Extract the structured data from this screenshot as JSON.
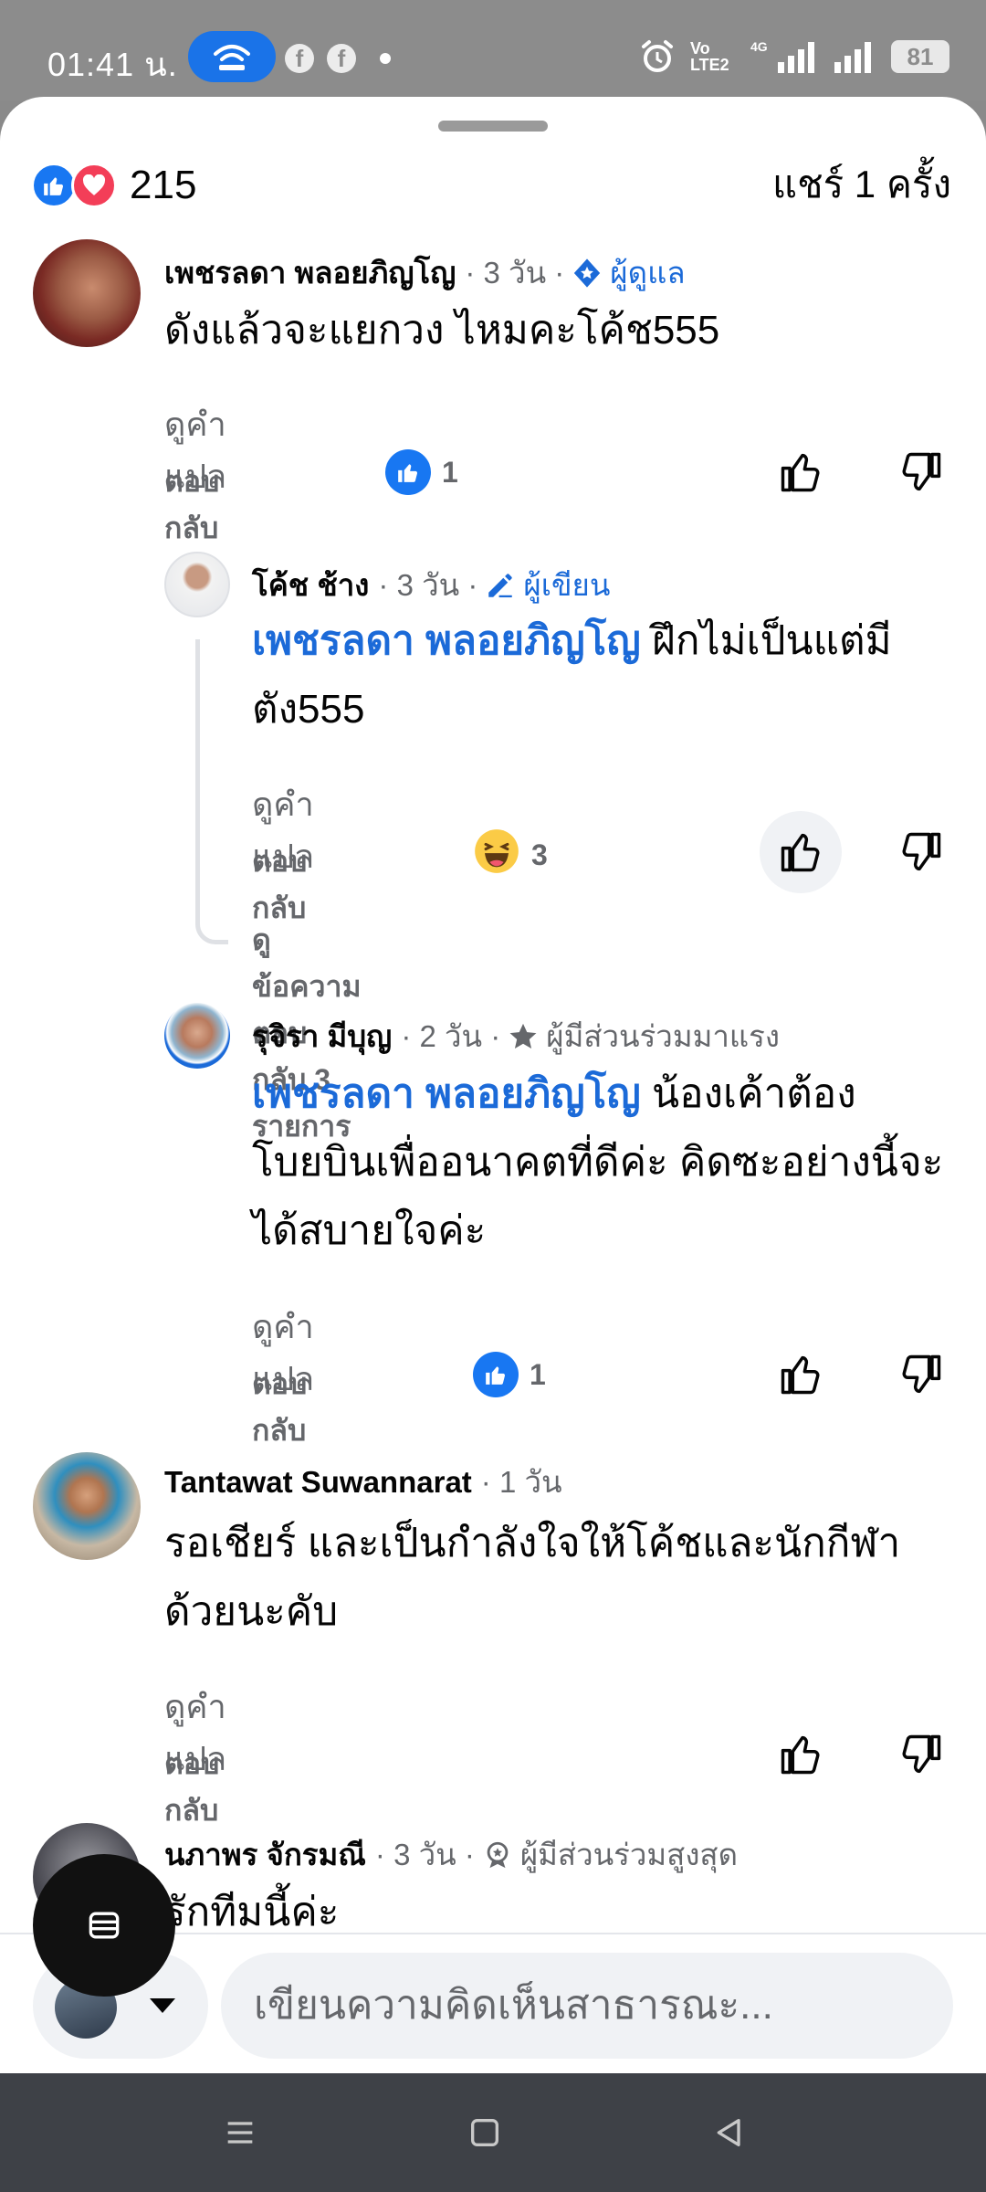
{
  "status_bar": {
    "time": "01:41 น.",
    "network_label": "Vo LTE2",
    "network_type": "4G",
    "battery": "81"
  },
  "summary": {
    "reaction_count": "215",
    "share_text": "แชร์ 1 ครั้ง"
  },
  "comments": [
    {
      "name": "เพชรลดา พลอยภิญโญ",
      "time": "· 3 วัน ·",
      "badge": "ผู้ดูแล",
      "text": "ดังแล้วจะแยกวง ไหมคะโค้ช555",
      "translate": "ดูคำแปล",
      "reply": "ตอบกลับ",
      "reaction_count": "1"
    },
    {
      "name": "โค้ช ช้าง",
      "time": "· 3 วัน ·",
      "badge": "ผู้เขียน",
      "mention": "เพชรลดา พลอยภิญโญ",
      "text": " ฝึกไม่เป็นแต่มีตัง555",
      "translate": "ดูคำแปล",
      "reply": "ตอบกลับ",
      "reaction_count": "3",
      "view_replies": "ดูข้อความตอบกลับ 3 รายการ"
    },
    {
      "name": "รุจิรา มีบุญ",
      "time": "· 2 วัน ·",
      "badge": "ผู้มีส่วนร่วมมาแรง",
      "mention": "เพชรลดา พลอยภิญโญ",
      "text": " น้องเค้าต้องโบยบินเพื่ออนาคตที่ดีค่ะ คิดซะอย่างนี้จะได้สบายใจค่ะ",
      "translate": "ดูคำแปล",
      "reply": "ตอบกลับ",
      "reaction_count": "1"
    },
    {
      "name": "Tantawat Suwannarat",
      "time": "· 1 วัน",
      "text": "รอเชียร์ และเป็นกำลังใจให้โค้ชและนักกีฬาด้วยนะคับ",
      "translate": "ดูคำแปล",
      "reply": "ตอบกลับ"
    },
    {
      "name": "นภาพร จักรมณี",
      "time": "· 3 วัน ·",
      "badge": "ผู้มีส่วนร่วมสูงสุด",
      "text": "รักทีมนี้ค่ะ"
    }
  ],
  "composer": {
    "placeholder": "เขียนความคิดเห็นสาธารณะ..."
  },
  "colors": {
    "accent": "#1877f2",
    "love": "#f33e58",
    "link": "#1b6ad8",
    "muted": "#65676b"
  }
}
